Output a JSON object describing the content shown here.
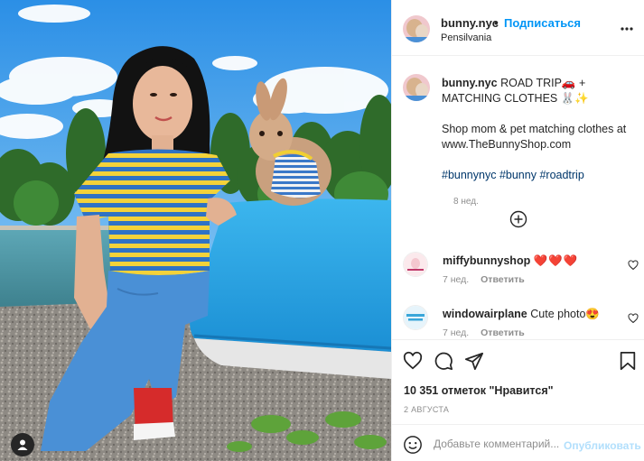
{
  "header": {
    "username": "bunny.nyc",
    "separator": "•",
    "follow_label": "Подписаться",
    "location": "Pensilvania",
    "more_icon": "more-horizontal-icon"
  },
  "caption": {
    "username": "bunny.nyc",
    "line1": "ROAD TRIP🚗 + MATCHING CLOTHES 🐰✨",
    "line2": "Shop mom & pet matching clothes at www.TheBunnyShop.com",
    "hashtags": [
      "#bunnynyc",
      "#bunny",
      "#roadtrip"
    ],
    "time": "8 нед.",
    "load_more_icon": "plus-circle-icon"
  },
  "comments": [
    {
      "username": "miffybunnyshop",
      "text": "❤️❤️❤️",
      "time": "7 нед.",
      "reply_label": "Ответить"
    },
    {
      "username": "windowairplane",
      "text": "Cute photo😍",
      "time": "7 нед.",
      "reply_label": "Ответить"
    }
  ],
  "actions": {
    "likes": "10 351 отметок \"Нравится\"",
    "date": "2 АВГУСТА",
    "icons": [
      "heart-icon",
      "comment-icon",
      "share-icon",
      "bookmark-icon"
    ]
  },
  "add_comment": {
    "placeholder": "Добавьте комментарий...",
    "publish_label": "Опубликовать"
  },
  "colors": {
    "link_blue": "#0095f6",
    "hashtag": "#00376b",
    "muted": "#8e8e8e",
    "heart_red": "#ed2d3a",
    "boat_blue": "#24a6e6"
  }
}
